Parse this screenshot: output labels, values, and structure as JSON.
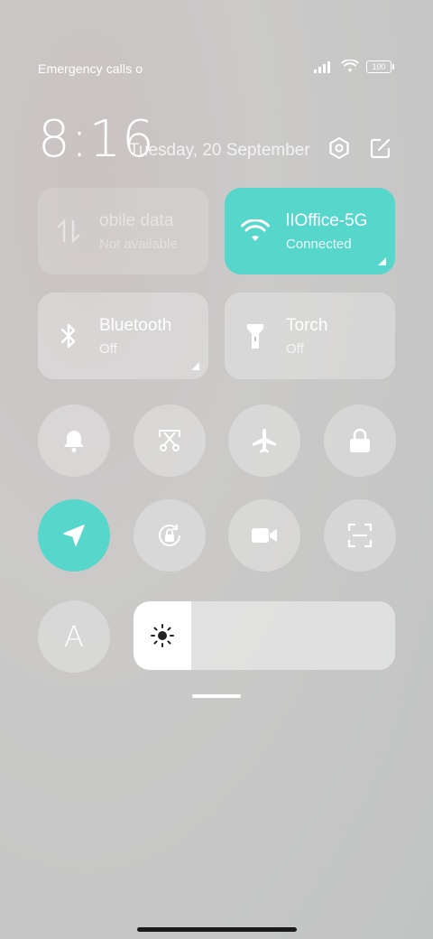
{
  "status_bar": {
    "carrier_text": "Emergency calls o",
    "battery_level": "100",
    "icons": [
      "signal-icon",
      "wifi-icon",
      "battery-icon"
    ]
  },
  "header": {
    "time": "8:16",
    "date": "Tuesday, 20 September",
    "settings_icon": "gear-icon",
    "edit_icon": "edit-icon"
  },
  "tiles": [
    {
      "name": "mobile-data",
      "title": "obile data",
      "subtitle": "Not available",
      "icon": "mobile-data-icon",
      "state": "disabled"
    },
    {
      "name": "wifi",
      "title": "lIOffice-5G",
      "subtitle": "Connected",
      "icon": "wifi-icon",
      "state": "active"
    },
    {
      "name": "bluetooth",
      "title": "Bluetooth",
      "subtitle": "Off",
      "icon": "bluetooth-icon",
      "state": "off"
    },
    {
      "name": "torch",
      "title": "Torch",
      "subtitle": "Off",
      "icon": "torch-icon",
      "state": "off"
    }
  ],
  "toggles_row1": [
    "bell-icon",
    "screenshot-icon",
    "airplane-icon",
    "lock-icon"
  ],
  "toggles_row2": [
    "location-icon",
    "rotation-lock-icon",
    "video-icon",
    "scan-icon"
  ],
  "accent_color": "#57d6cb",
  "auto_brightness_label": "A",
  "brightness_level": 0.22
}
